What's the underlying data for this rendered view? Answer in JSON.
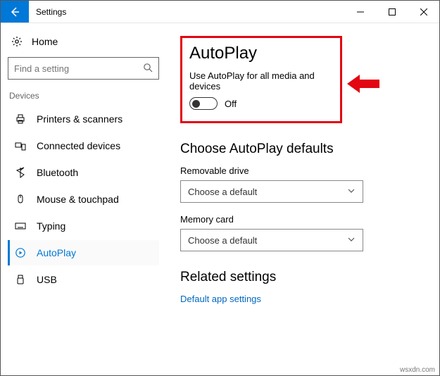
{
  "titlebar": {
    "title": "Settings"
  },
  "sidebar": {
    "home": "Home",
    "search_placeholder": "Find a setting",
    "group": "Devices",
    "items": [
      {
        "label": "Printers & scanners"
      },
      {
        "label": "Connected devices"
      },
      {
        "label": "Bluetooth"
      },
      {
        "label": "Mouse & touchpad"
      },
      {
        "label": "Typing"
      },
      {
        "label": "AutoPlay"
      },
      {
        "label": "USB"
      }
    ]
  },
  "main": {
    "heading": "AutoPlay",
    "toggle_desc": "Use AutoPlay for all media and devices",
    "toggle_state": "Off",
    "defaults_heading": "Choose AutoPlay defaults",
    "removable_label": "Removable drive",
    "removable_value": "Choose a default",
    "memory_label": "Memory card",
    "memory_value": "Choose a default",
    "related_heading": "Related settings",
    "related_link": "Default app settings"
  },
  "watermark": "wsxdn.com"
}
